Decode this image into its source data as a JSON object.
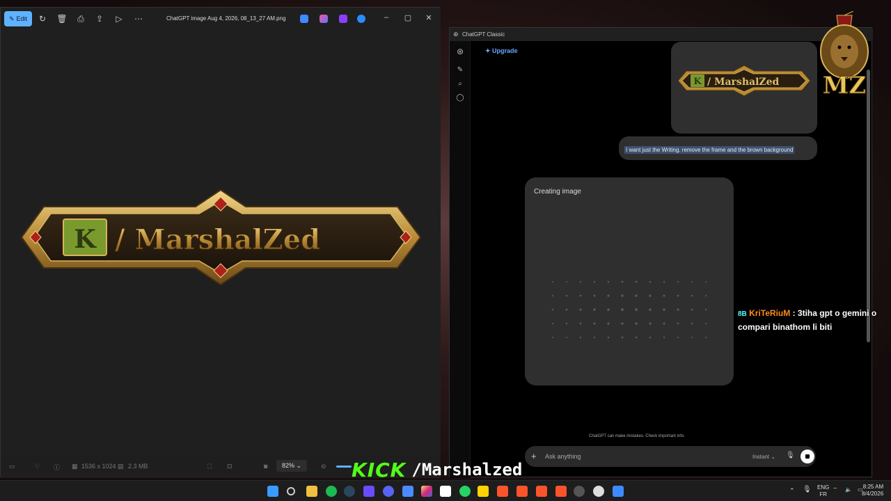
{
  "photos": {
    "edit_label": "Edit",
    "file_name": "ChatGPT image Aug 4, 2026, 08_13_27 AM.png",
    "dimensions": "1536 x 1024",
    "file_size": "2.3 MB",
    "zoom": "82%",
    "logo_text": "/ MarshalZed",
    "logo_badge": "K"
  },
  "chat": {
    "window_title": "ChatGPT Classic",
    "upgrade_label": "✦ Upgrade",
    "sent_image_text": "/ MarshalZed",
    "sent_image_badge": "K",
    "user_message": "I want just the Writing. remove the frame and the brown background",
    "generating_label": "Creating image",
    "disclaimer": "ChatGPT can make mistakes. Check important info.",
    "input_placeholder": "Ask anything",
    "mode_label": "Instant ⌄"
  },
  "overlay": {
    "username": "KriTeRiuM",
    "message_prefix": " : ",
    "message": "3tiha gpt o gemini o compari binathom li biti",
    "emote": "8B"
  },
  "kick": {
    "brand": "KICK",
    "channel": "/Marshalzed"
  },
  "mz_logo": "MZ",
  "tray": {
    "lang_top": "ENG",
    "lang_bottom": "FR",
    "time": "8:25 AM",
    "date": "8/4/2026"
  },
  "colors": {
    "accent": "#5fb2ff",
    "kick_green": "#53fc18",
    "gold": "#c9a24a",
    "olive": "#7a9a2e"
  }
}
